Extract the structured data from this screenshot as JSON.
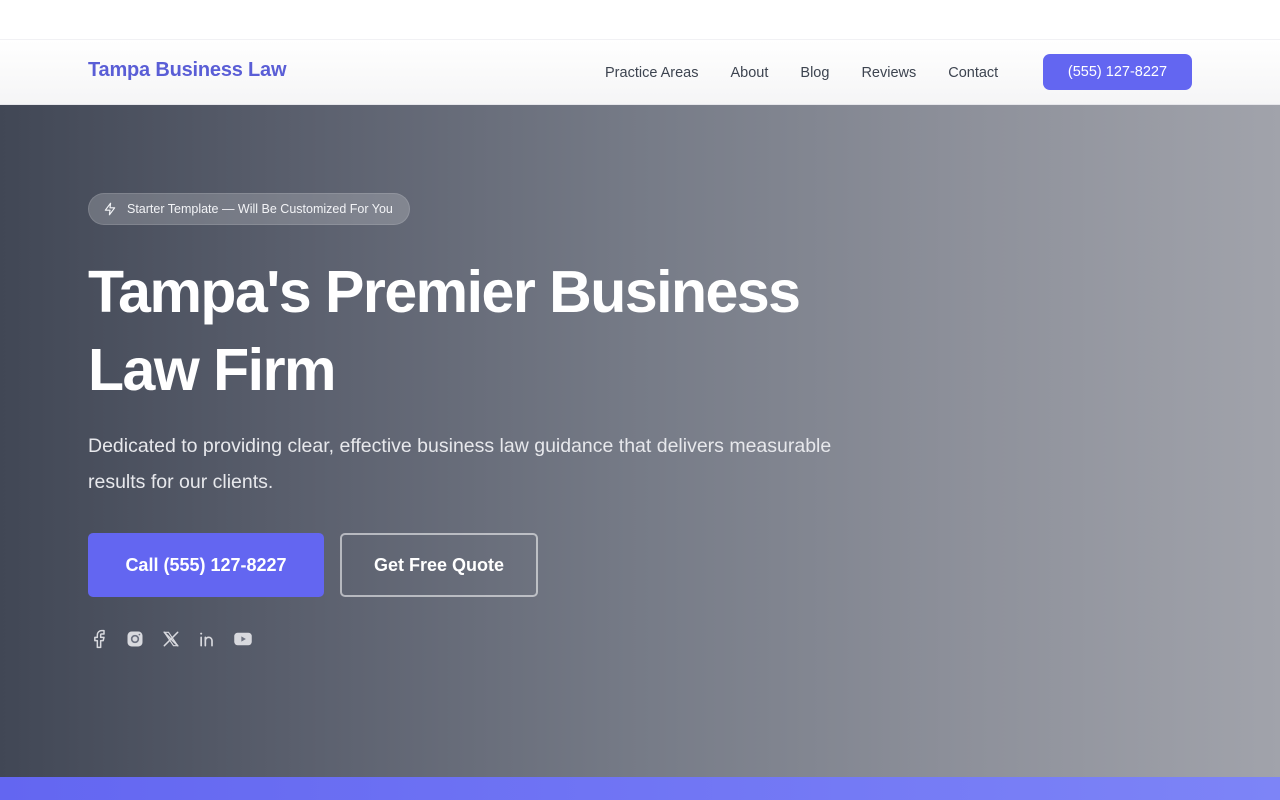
{
  "header": {
    "brand": "Tampa Business Law",
    "nav": [
      "Practice Areas",
      "About",
      "Blog",
      "Reviews",
      "Contact"
    ],
    "cta_label": "(555) 127-8227"
  },
  "hero": {
    "badge_icon": "sparkle-icon",
    "badge_text": "Starter Template — Will Be Customized For You",
    "title_line1": "Tampa's Premier Business",
    "title_line2": "Law Firm",
    "subtitle": "Dedicated to providing clear, effective business law guidance that delivers measurable results for our clients.",
    "primary_button": "Call (555) 127-8227",
    "secondary_button": "Get Free Quote",
    "social_icons": [
      "facebook-icon",
      "instagram-icon",
      "x-icon",
      "linkedin-icon",
      "youtube-icon"
    ]
  },
  "colors": {
    "accent": "#6366f1",
    "brand_text": "#5a5ed6",
    "hero_gradient_start": "#414755",
    "hero_gradient_end": "#a1a3ab"
  }
}
